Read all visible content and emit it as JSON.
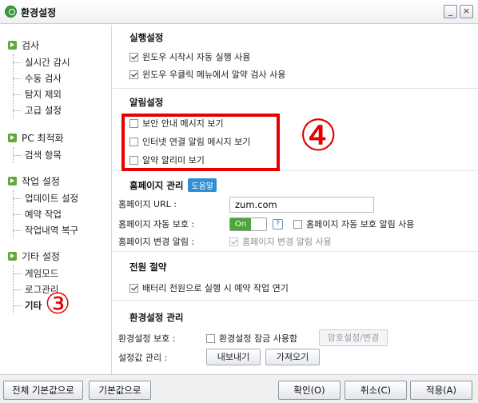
{
  "window": {
    "title": "환경설정",
    "app_icon": "app-logo-icon",
    "controls": {
      "minimize": "_",
      "close": "×"
    }
  },
  "sidebar": {
    "groups": [
      {
        "label": "검사",
        "items": [
          "실시간 감시",
          "수동 검사",
          "탐지 제외",
          "고급 설정"
        ]
      },
      {
        "label": "PC 최적화",
        "items": [
          "검색 항목"
        ]
      },
      {
        "label": "작업 설정",
        "items": [
          "업데이트 설정",
          "예약 작업",
          "작업내역 복구"
        ]
      },
      {
        "label": "기타 설정",
        "items": [
          "게임모드",
          "로그관리",
          "기타"
        ]
      }
    ],
    "active_item": "기타"
  },
  "sections": {
    "run": {
      "title": "실행설정",
      "options": [
        {
          "label": "윈도우 시작시 자동 실행 사용",
          "checked": true
        },
        {
          "label": "윈도우 우클릭 메뉴에서 알약 검사 사용",
          "checked": true
        }
      ]
    },
    "alert": {
      "title": "알림설정",
      "options": [
        {
          "label": "보안 안내 메시지 보기",
          "checked": false
        },
        {
          "label": "인터넷 연결 알림 메시지 보기",
          "checked": false
        },
        {
          "label": "알약 알리미 보기",
          "checked": false
        }
      ]
    },
    "homepage": {
      "title": "홈페이지 관리",
      "help_label": "도움말",
      "url_label": "홈페이지 URL :",
      "url_value": "zum.com",
      "auto_protect_label": "홈페이지 자동 보호 :",
      "toggle_label": "On",
      "help_icon_label": "?",
      "auto_protect_alert_label": "홈페이지 자동 보호 알림 사용",
      "change_alert_label": "홈페이지 변경 알림 :",
      "change_alert_option": "홈페이지 변경 알림 사용"
    },
    "power": {
      "title": "전원 절약",
      "option": "배터리 전원으로 실행 시 예약 작업 연기"
    },
    "env": {
      "title": "환경설정 관리",
      "protect_label": "환경설정 보호 :",
      "lock_label": "환경설정 잠금 사용함",
      "password_button": "암호설정/변경",
      "manage_label": "설정값 관리 :",
      "export_button": "내보내기",
      "import_button": "가져오기"
    }
  },
  "annotations": {
    "circle_four": "④",
    "circle_three": "③",
    "highlight_color": "#e60000"
  },
  "footer": {
    "reset_all": "전체 기본값으로",
    "reset_default": "기본값으로",
    "ok": "확인(O)",
    "cancel": "취소(C)",
    "apply": "적용(A)"
  },
  "colors": {
    "toggle_on": "#49a834",
    "help_badge": "#2f8fd1",
    "group_icon": "#63a83b"
  }
}
